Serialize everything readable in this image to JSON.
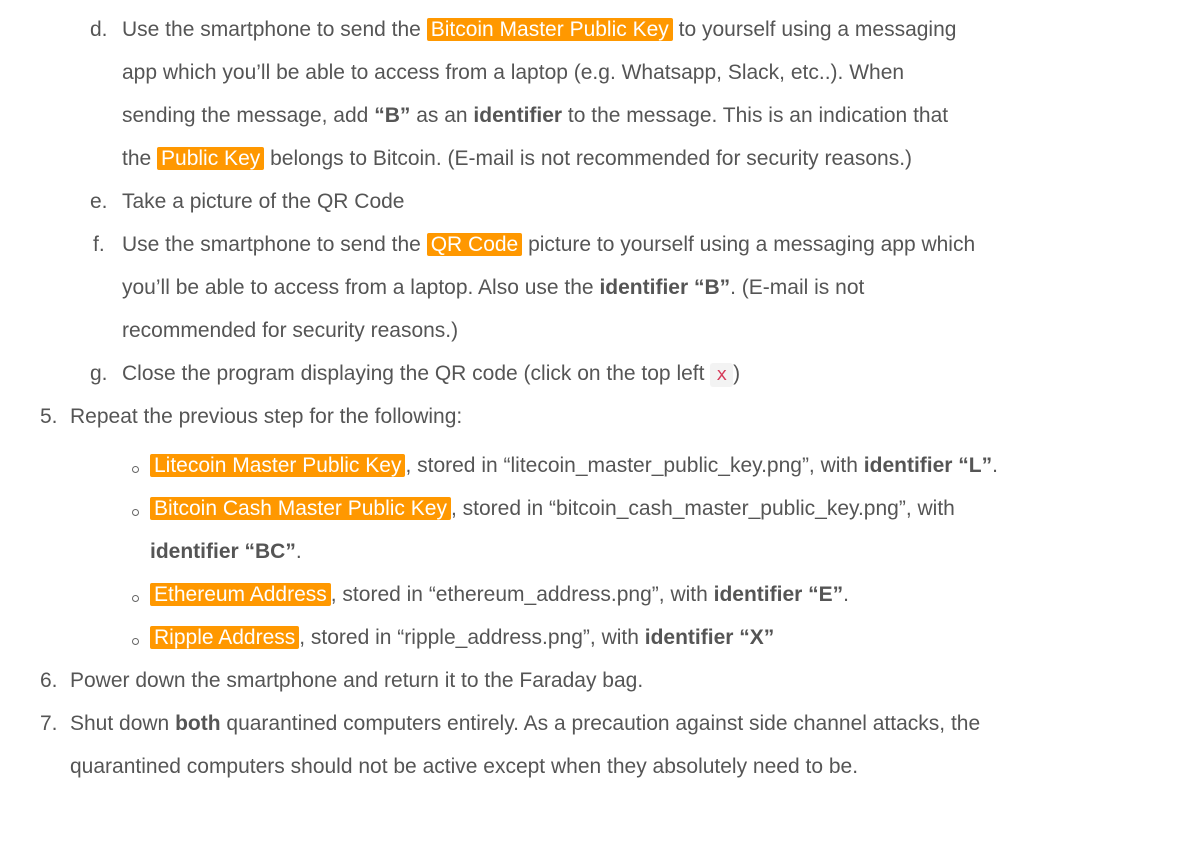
{
  "item_d": {
    "marker": "d.",
    "l1_a": "Use the smartphone to send the ",
    "l1_hl": "Bitcoin Master Public Key",
    "l1_b": " to yourself using a messaging",
    "l2": "app which you’ll be able to access from a laptop (e.g. Whatsapp, Slack, etc..). When",
    "l3_a": "sending the message, add ",
    "l3_b1": "“B”",
    "l3_c": " as an ",
    "l3_b2": "identifier",
    "l3_d": " to the message. This is an indication that",
    "l4_a": "the ",
    "l4_hl": "Public Key",
    "l4_b": " belongs to Bitcoin. (E-mail is not recommended for security reasons.)"
  },
  "item_e": {
    "marker": "e.",
    "text": "Take a picture of the QR Code"
  },
  "item_f": {
    "marker": "f.",
    "l1_a": "Use the smartphone to send the ",
    "l1_hl": "QR Code",
    "l1_b": " picture to yourself using a messaging app which",
    "l2_a": "you’ll be able to access from a laptop. Also use the ",
    "l2_b": "identifier “B”",
    "l2_c": ". (E-mail is not",
    "l3": "recommended for security reasons.)"
  },
  "item_g": {
    "marker": "g.",
    "text_a": "Close the program displaying the QR code (click on the top left ",
    "code": "x",
    "text_b": ")"
  },
  "step_5": {
    "marker": "5.",
    "text": "Repeat the previous step for the following:",
    "bullets": [
      {
        "hl": "Litecoin Master Public Key",
        "text": ", stored in “litecoin_master_public_key.png”, with ",
        "bold": "identifier “L”",
        "tail": "."
      },
      {
        "hl": "Bitcoin Cash Master Public Key",
        "text": ", stored in “bitcoin_cash_master_public_key.png”, with",
        "cont_bold": "identifier “BC”",
        "cont_tail": "."
      },
      {
        "hl": "Ethereum Address",
        "text": ", stored in “ethereum_address.png”, with ",
        "bold": "identifier “E”",
        "tail": "."
      },
      {
        "hl": "Ripple Address",
        "text": ", stored in “ripple_address.png”, with ",
        "bold": "identifier “X”",
        "tail": ""
      }
    ]
  },
  "step_6": {
    "marker": "6.",
    "text": "Power down the smartphone and return it to the Faraday bag."
  },
  "step_7": {
    "marker": "7.",
    "l1_a": "Shut down ",
    "l1_b": "both",
    "l1_c": " quarantined computers entirely. As a precaution against side channel attacks, the",
    "l2": "quarantined computers should not be active except when they absolutely need to be."
  }
}
